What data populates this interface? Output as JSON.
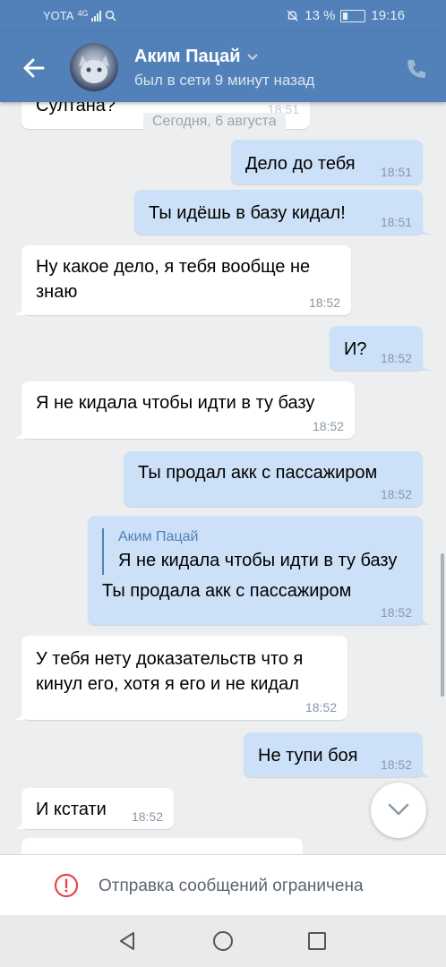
{
  "status_bar": {
    "carrier": "YOTA",
    "network": "4G",
    "battery_percent": "13 %",
    "time": "19:16"
  },
  "header": {
    "contact_name": "Аким Пацай",
    "last_seen": "был в сети 9 минут назад",
    "accent_color": "#5181b8"
  },
  "chat": {
    "date_separator": "Сегодня, 6 августа",
    "partial_top": {
      "text": "Султана?",
      "time": "18:51"
    },
    "messages": [
      {
        "dir": "out",
        "text": "Дело до тебя",
        "time": "18:51"
      },
      {
        "dir": "out",
        "text": "Ты идёшь в базу кидал!",
        "time": "18:51"
      },
      {
        "dir": "in",
        "text": "Ну какое дело, я тебя вообще не знаю",
        "time": "18:52"
      },
      {
        "dir": "out",
        "text": "И?",
        "time": "18:52"
      },
      {
        "dir": "in",
        "text": "Я не кидала чтобы идти в ту базу",
        "time": "18:52"
      },
      {
        "dir": "out",
        "text": "Ты продал акк с пассажиром",
        "time": "18:52"
      },
      {
        "dir": "out",
        "reply_author": "Аким Пацай",
        "reply_text": "Я не кидала чтобы идти в ту базу",
        "text": "Ты продала акк с пассажиром",
        "time": "18:52"
      },
      {
        "dir": "in",
        "text": "У тебя нету доказательств что я кинул его, хотя я его и не кидал",
        "time": "18:52"
      },
      {
        "dir": "out",
        "text": "Не тупи боя",
        "time": "18:52"
      },
      {
        "dir": "in",
        "text": "И кстати",
        "time": "18:52"
      }
    ]
  },
  "restriction": {
    "label": "Отправка сообщений ограничена",
    "icon": "alert-circle-icon"
  },
  "nav": {
    "back": "back-triangle-icon",
    "home": "home-circle-icon",
    "recents": "recents-square-icon"
  }
}
